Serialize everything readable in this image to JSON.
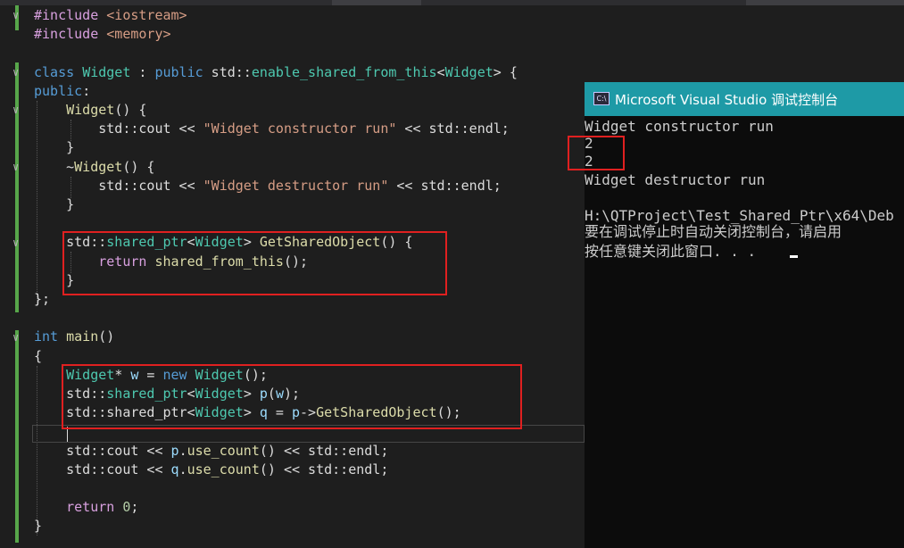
{
  "editor": {
    "lines": [
      {
        "row": 0,
        "html": "<span class=\"kw2\">#include</span> <span class=\"str\">&lt;iostream&gt;</span>"
      },
      {
        "row": 1,
        "html": "<span class=\"kw2\">#include</span> <span class=\"str\">&lt;memory&gt;</span>"
      },
      {
        "row": 3,
        "html": "<span class=\"kw\">class</span> <span class=\"type\">Widget</span> : <span class=\"kw\">public</span> std::<span class=\"type\">enable_shared_from_this</span>&lt;<span class=\"type\">Widget</span>&gt; {"
      },
      {
        "row": 4,
        "html": "<span class=\"kw\">public</span>:"
      },
      {
        "row": 5,
        "html": "    <span class=\"fn\">Widget</span>() {"
      },
      {
        "row": 6,
        "html": "        std::cout &lt;&lt; <span class=\"str\">\"Widget constructor run\"</span> &lt;&lt; std::endl;"
      },
      {
        "row": 7,
        "html": "    }"
      },
      {
        "row": 8,
        "html": "    ~<span class=\"fn\">Widget</span>() {"
      },
      {
        "row": 9,
        "html": "        std::cout &lt;&lt; <span class=\"str\">\"Widget destructor run\"</span> &lt;&lt; std::endl;"
      },
      {
        "row": 10,
        "html": "    }"
      },
      {
        "row": 12,
        "html": "    std::<span class=\"type\">shared_ptr</span>&lt;<span class=\"type\">Widget</span>&gt; <span class=\"fn\">GetSharedObject</span>() {"
      },
      {
        "row": 13,
        "html": "        <span class=\"kw2\">return</span> <span class=\"fn\">shared_from_this</span>();"
      },
      {
        "row": 14,
        "html": "    }"
      },
      {
        "row": 15,
        "html": "};"
      },
      {
        "row": 17,
        "html": "<span class=\"kw\">int</span> <span class=\"fn\">main</span>()"
      },
      {
        "row": 18,
        "html": "{"
      },
      {
        "row": 19,
        "html": "    <span class=\"type\">Widget</span>* <span class=\"var\">w</span> = <span class=\"kw\">new</span> <span class=\"type\">Widget</span>();"
      },
      {
        "row": 20,
        "html": "    std::<span class=\"type\">shared_ptr</span>&lt;<span class=\"type\">Widget</span>&gt; <span class=\"var\">p</span>(<span class=\"var\">w</span>);"
      },
      {
        "row": 21,
        "html": "    std::shared_ptr&lt;<span class=\"type\">Widget</span>&gt; <span class=\"var\">q</span> = <span class=\"var\">p</span>-&gt;<span class=\"fn\">GetSharedObject</span>();"
      },
      {
        "row": 23,
        "html": "    std::cout &lt;&lt; <span class=\"var\">p</span>.<span class=\"fn\">use_count</span>() &lt;&lt; std::endl;"
      },
      {
        "row": 24,
        "html": "    std::cout &lt;&lt; <span class=\"var\">q</span>.<span class=\"fn\">use_count</span>() &lt;&lt; std::endl;"
      },
      {
        "row": 26,
        "html": "    <span class=\"kw2\">return</span> <span class=\"num\">0</span>;"
      },
      {
        "row": 27,
        "html": "}"
      }
    ]
  },
  "console": {
    "title": "Microsoft Visual Studio 调试控制台",
    "icon_label": "C:\\",
    "lines": [
      "Widget constructor run",
      "2",
      "2",
      "Widget destructor run",
      "",
      "H:\\QTProject\\Test_Shared_Ptr\\x64\\Deb",
      "要在调试停止时自动关闭控制台，请启用",
      "按任意键关闭此窗口. . ."
    ]
  },
  "colors": {
    "editor_bg": "#1e1e1e",
    "console_bg": "#0c0c0c",
    "console_title_bg": "#1e9aa6",
    "highlight_box": "#e02020",
    "change_bar": "#57a64a"
  }
}
